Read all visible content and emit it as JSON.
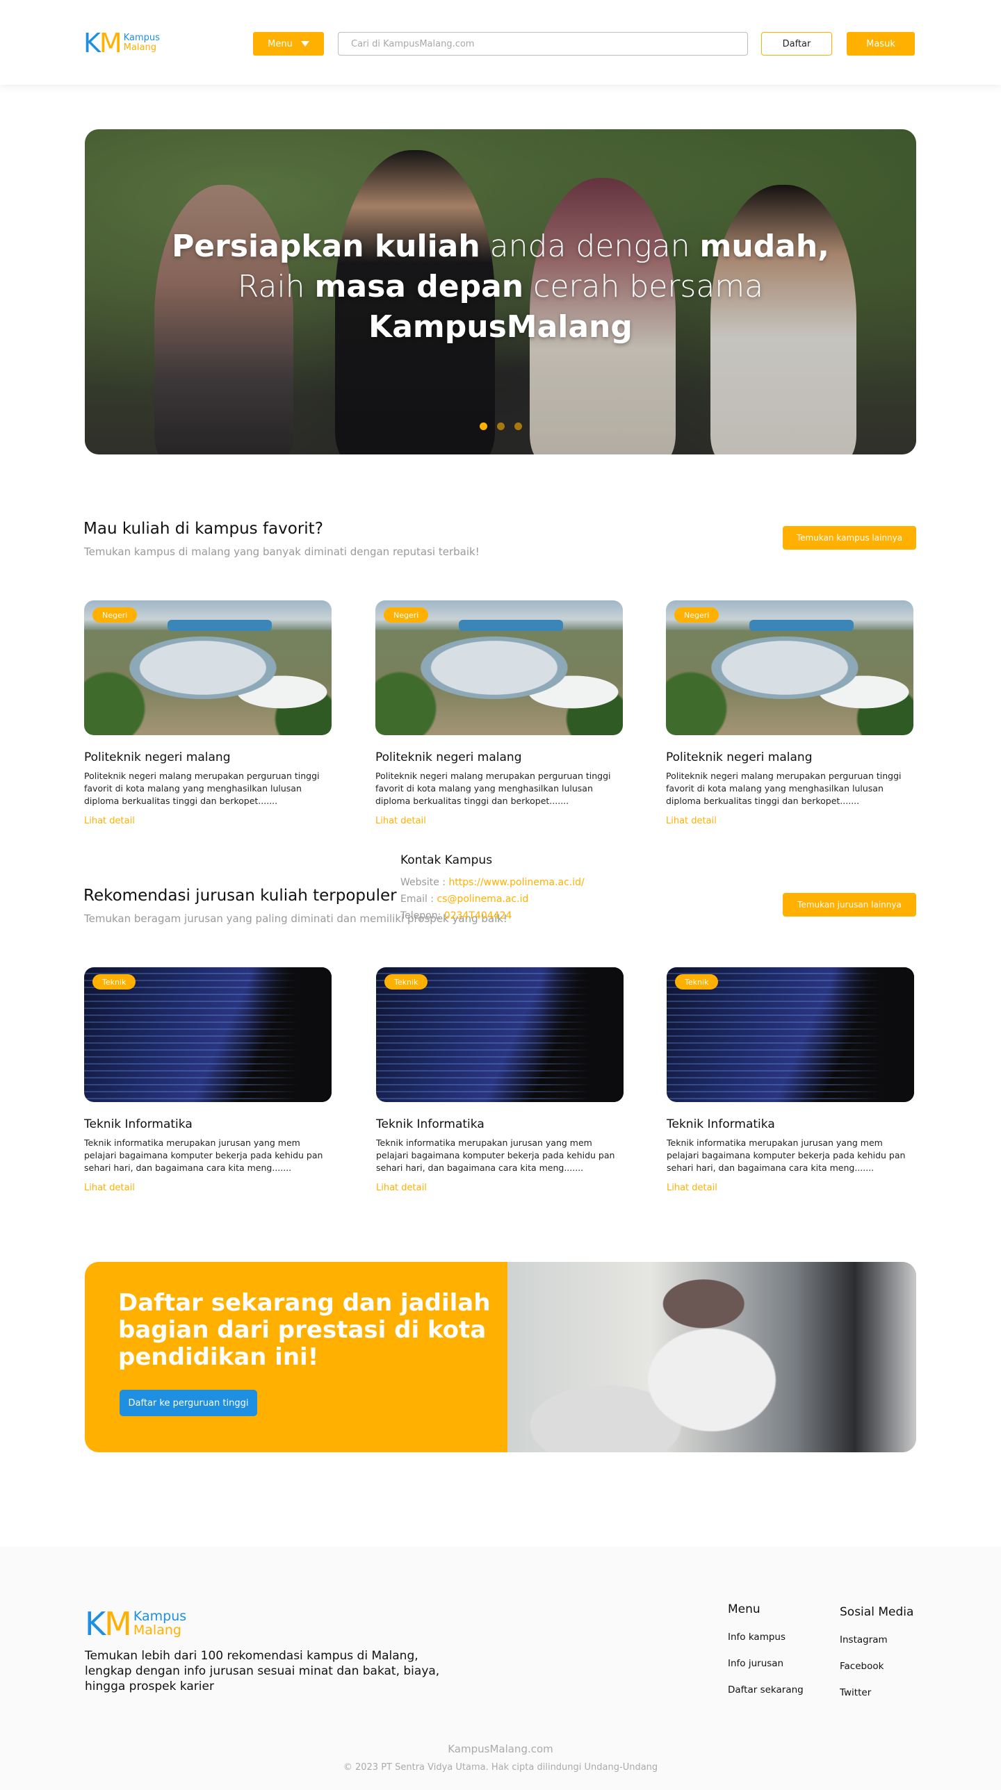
{
  "header": {
    "logo": {
      "k": "K",
      "m": "M",
      "line1": "Kampus",
      "line2": "Malang"
    },
    "menu_label": "Menu",
    "search_placeholder": "Cari di KampusMalang.com",
    "register_label": "Daftar",
    "login_label": "Masuk"
  },
  "hero": {
    "line1": [
      {
        "text": "Persiapkan kuliah",
        "bold": true
      },
      {
        "text": " anda dengan ",
        "bold": false
      },
      {
        "text": "mudah,",
        "bold": true
      }
    ],
    "line2": [
      {
        "text": "Raih ",
        "bold": false
      },
      {
        "text": "masa depan",
        "bold": true
      },
      {
        "text": " cerah bersama",
        "bold": false
      }
    ],
    "line3": [
      {
        "text": "KampusMalang",
        "bold": true
      }
    ],
    "slides": 3,
    "active_slide": 1
  },
  "campus_section": {
    "title": "Mau kuliah di kampus favorit?",
    "subtitle": "Temukan kampus di malang yang banyak diminati dengan reputasi terbaik!",
    "button": "Temukan kampus lainnya",
    "cards": [
      {
        "badge": "Negeri",
        "title": "Politeknik negeri malang",
        "desc": "Politeknik negeri malang merupakan perguruan tinggi favorit di kota malang yang menghasilkan lulusan diploma berkualitas tinggi dan berkopet.......",
        "more": "Lihat detail"
      },
      {
        "badge": "Negeri",
        "title": "Politeknik negeri malang",
        "desc": "Politeknik negeri malang merupakan perguruan tinggi favorit di kota malang yang menghasilkan lulusan diploma berkualitas tinggi dan berkopet.......",
        "more": "Lihat detail"
      },
      {
        "badge": "Negeri",
        "title": "Politeknik negeri malang",
        "desc": "Politeknik negeri malang merupakan perguruan tinggi favorit di kota malang yang menghasilkan lulusan diploma berkualitas tinggi dan berkopet.......",
        "more": "Lihat detail"
      }
    ]
  },
  "contact_overlay": {
    "title": "Kontak Kampus",
    "website_label": "Website : ",
    "website": "https://www.polinema.ac.id/",
    "email_label": "Email : ",
    "email": "cs@polinema.ac.id",
    "phone_label": "Telepon: ",
    "phone": "0234T404424"
  },
  "major_section": {
    "title": "Rekomendasi jurusan kuliah terpopuler",
    "subtitle": "Temukan beragam jurusan yang paling diminati dan memiliki prospek yang baik!",
    "button": "Temukan jurusan lainnya",
    "cards": [
      {
        "badge": "Teknik",
        "title": "Teknik Informatika",
        "desc": "Teknik informatika merupakan jurusan yang mem pelajari bagaimana komputer bekerja pada kehidu pan sehari hari, dan bagaimana cara kita meng.......",
        "more": "Lihat detail"
      },
      {
        "badge": "Teknik",
        "title": "Teknik Informatika",
        "desc": "Teknik informatika merupakan jurusan yang mem pelajari bagaimana komputer bekerja pada kehidu pan sehari hari, dan bagaimana cara kita meng.......",
        "more": "Lihat detail"
      },
      {
        "badge": "Teknik",
        "title": "Teknik Informatika",
        "desc": "Teknik informatika merupakan jurusan yang mem pelajari bagaimana komputer bekerja pada kehidu pan sehari hari, dan bagaimana cara kita meng.......",
        "more": "Lihat detail"
      }
    ]
  },
  "cta": {
    "title": "Daftar sekarang dan jadilah bagian dari prestasi di kota pendidikan ini!",
    "button": "Daftar ke perguruan tinggi"
  },
  "footer": {
    "logo": {
      "k": "K",
      "m": "M",
      "line1": "Kampus",
      "line2": "Malang"
    },
    "description": "Temukan lebih dari 100 rekomendasi kampus di Malang, lengkap dengan info jurusan sesuai minat dan bakat, biaya, hingga prospek karier",
    "menu": {
      "heading": "Menu",
      "items": [
        "Info kampus",
        "Info jurusan",
        "Daftar sekarang"
      ]
    },
    "social": {
      "heading": "Sosial Media",
      "items": [
        "Instagram",
        "Facebook",
        "Twitter"
      ]
    },
    "brand": "KampusMalang.com",
    "copyright": "© 2023 PT Sentra Vidya Utama. Hak cipta dilindungi Undang-Undang"
  },
  "colors": {
    "accent": "#ffb000",
    "brand_blue": "#1e8fe1",
    "muted_text": "#9a9a9a"
  },
  "icons": {
    "menu_caret": "chevron-down-icon"
  }
}
